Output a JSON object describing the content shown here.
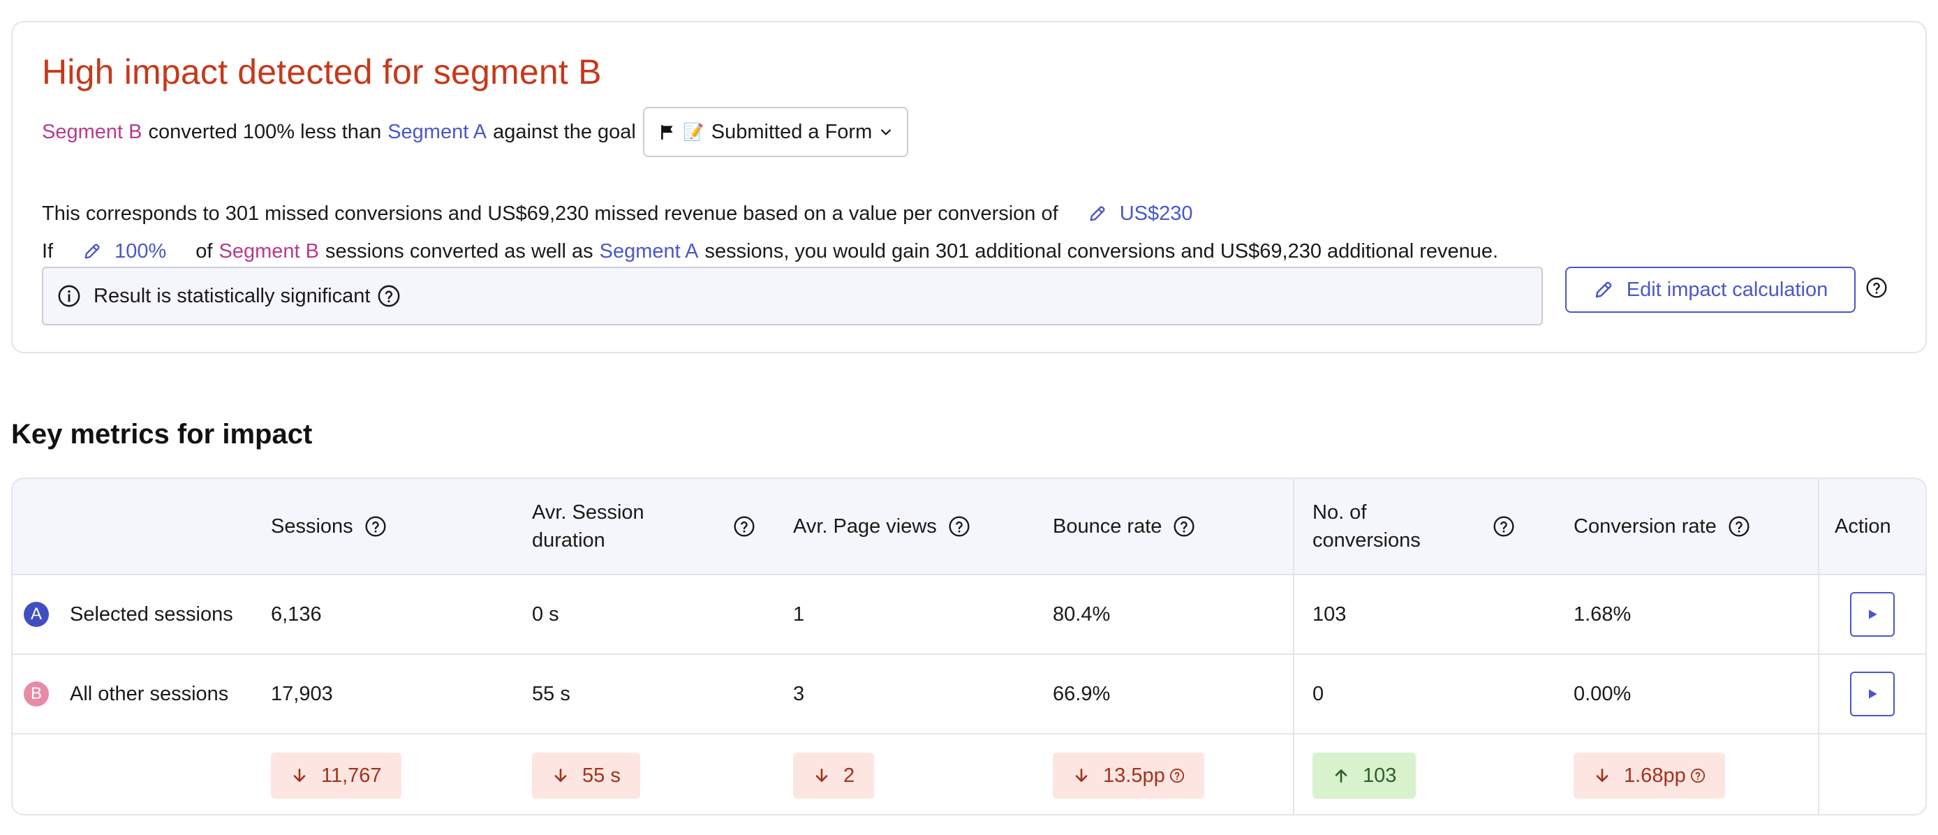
{
  "impact": {
    "title": "High impact detected for segment B",
    "segment_b": "Segment B",
    "segment_a": "Segment A",
    "converted_text": "converted 100% less than",
    "against_goal": "against the goal",
    "goal_label": "Submitted a Form",
    "goal_emoji": "📝",
    "corresponds_text": "This corresponds to 301 missed conversions and US$69,230 missed revenue based on a value per conversion of",
    "value_per_conversion": "US$230",
    "if_text": "If",
    "percent_value": "100%",
    "of_text": "of",
    "sessions_converted_text": "sessions converted as well as",
    "gain_text": "sessions, you would gain 301 additional conversions and US$69,230 additional revenue.",
    "significance_text": "Result is statistically significant",
    "edit_button_label": "Edit impact calculation"
  },
  "metrics": {
    "title": "Key metrics for impact",
    "columns": [
      "Sessions",
      "Avr. Session duration",
      "Avr. Page views",
      "Bounce rate",
      "No. of conversions",
      "Conversion rate",
      "Action"
    ],
    "col_sessions": "Sessions",
    "col_duration_1": "Avr. Session",
    "col_duration_2": "duration",
    "col_pageviews": "Avr. Page views",
    "col_bounce": "Bounce rate",
    "col_conversions_1": "No. of",
    "col_conversions_2": "conversions",
    "col_conv_rate": "Conversion rate",
    "col_action": "Action",
    "rows": [
      {
        "badge": "A",
        "label": "Selected sessions",
        "sessions": "6,136",
        "duration": "0 s",
        "pageviews": "1",
        "bounce": "80.4%",
        "conversions": "103",
        "conv_rate": "1.68%"
      },
      {
        "badge": "B",
        "label": "All other sessions",
        "sessions": "17,903",
        "duration": "55 s",
        "pageviews": "3",
        "bounce": "66.9%",
        "conversions": "0",
        "conv_rate": "0.00%"
      }
    ],
    "deltas": {
      "sessions": "11,767",
      "duration": "55 s",
      "pageviews": "2",
      "bounce": "13.5pp",
      "conversions": "103",
      "conv_rate": "1.68pp"
    }
  },
  "colors": {
    "title_red": "#c6391b",
    "segment_a": "#4a57c9",
    "segment_b": "#b83a8e",
    "negative_bg": "#fde5e1",
    "positive_bg": "#d7f2cd"
  },
  "icons": {
    "flag": "flag-icon",
    "pencil": "pencil-icon",
    "info": "info-icon",
    "help": "help-circle-icon",
    "play": "play-icon",
    "arrow_down": "arrow-down-icon",
    "arrow_up": "arrow-up-icon",
    "chevron": "chevron-down-icon"
  }
}
